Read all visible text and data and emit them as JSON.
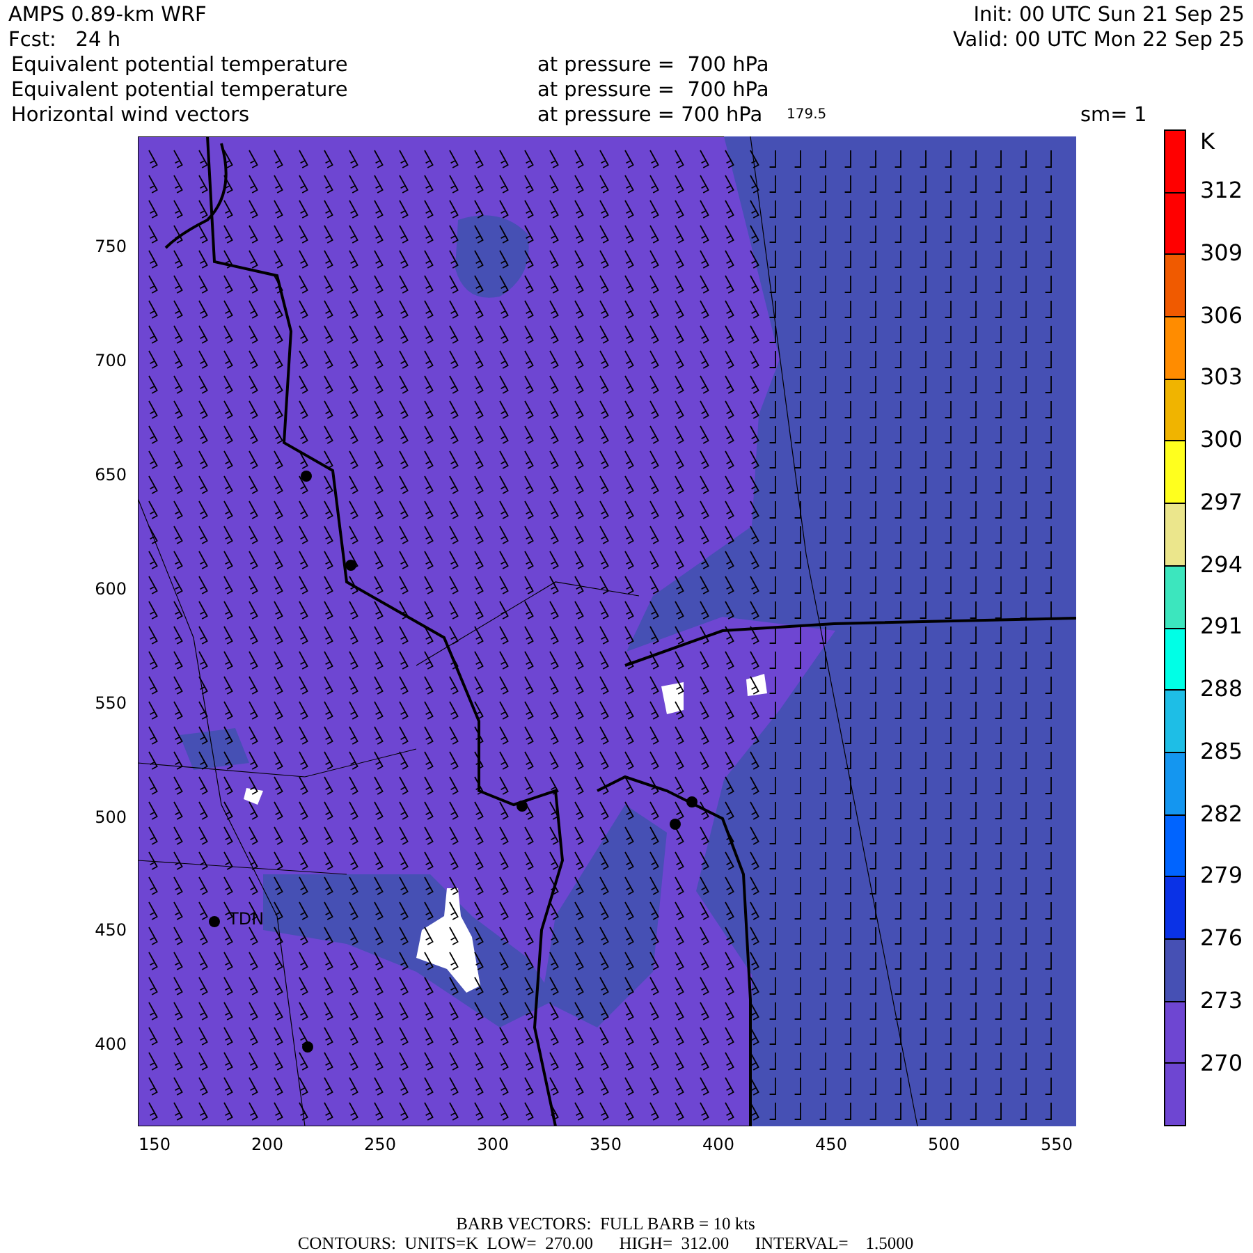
{
  "header": {
    "title": "AMPS 0.89-km WRF",
    "init": "Init: 00 UTC Sun 21 Sep 25",
    "forecast": "Fcst:   24 h",
    "valid": "Valid: 00 UTC Mon 22 Sep 25"
  },
  "fields": [
    {
      "name": "Equivalent potential temperature",
      "level": "at pressure =  700 hPa"
    },
    {
      "name": "Equivalent potential temperature",
      "level": "at pressure =  700 hPa"
    },
    {
      "name": "Horizontal wind vectors",
      "level": "at pressure = 700 hPa"
    }
  ],
  "smoothing": "sm= 1",
  "map": {
    "longitude_label": "179.5",
    "station": "TDN",
    "xticks": [
      "150",
      "200",
      "250",
      "300",
      "350",
      "400",
      "450",
      "500",
      "550"
    ],
    "yticks": [
      "750",
      "700",
      "650",
      "600",
      "550",
      "500",
      "450",
      "400"
    ]
  },
  "colorbar": {
    "unit": "K",
    "bins": [
      {
        "color": "#ff0000"
      },
      {
        "color": "#ff0000"
      },
      {
        "color": "#f05a00"
      },
      {
        "color": "#ff8c00"
      },
      {
        "color": "#f0b400"
      },
      {
        "color": "#ffff1e"
      },
      {
        "color": "#ebe68c"
      },
      {
        "color": "#3ce6be"
      },
      {
        "color": "#00ffe6"
      },
      {
        "color": "#1ebee6"
      },
      {
        "color": "#1496f0"
      },
      {
        "color": "#0064ff"
      },
      {
        "color": "#0a32e6"
      },
      {
        "color": "#4650b4"
      },
      {
        "color": "#6e46d2"
      },
      {
        "color": "#6e46d2"
      }
    ],
    "labels": [
      "312",
      "309",
      "306",
      "303",
      "300",
      "297",
      "294",
      "291",
      "288",
      "285",
      "282",
      "279",
      "276",
      "273",
      "270"
    ]
  },
  "footer": [
    "BARB VECTORS:  FULL BARB = 10 kts",
    "CONTOURS:  UNITS=K  LOW=  270.00      HIGH=  312.00      INTERVAL=    1.5000"
  ]
}
